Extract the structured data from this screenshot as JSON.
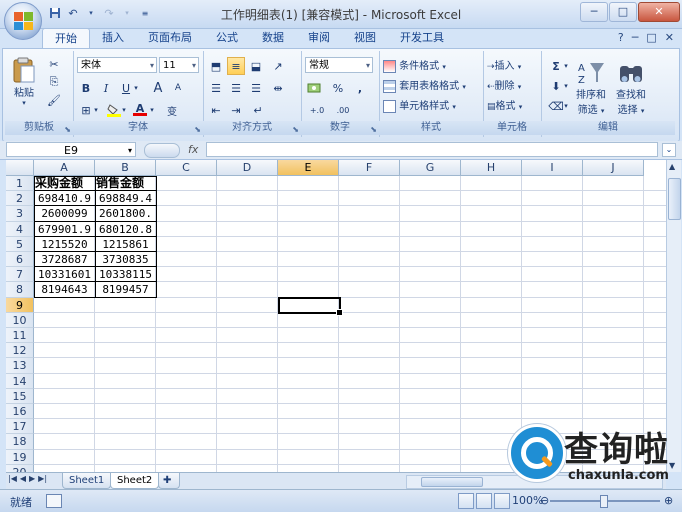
{
  "window": {
    "title": "工作明细表(1)  [兼容模式] - Microsoft Excel",
    "minimize": "─",
    "maximize": "□",
    "close": "✕"
  },
  "ribbon": {
    "tabs": [
      "开始",
      "插入",
      "页面布局",
      "公式",
      "数据",
      "审阅",
      "视图",
      "开发工具"
    ],
    "active_tab": "开始",
    "help_icons": [
      "?",
      "─",
      "□",
      "✕"
    ],
    "clipboard": {
      "paste": "粘贴",
      "label": "剪贴板"
    },
    "font": {
      "name": "宋体",
      "size": "11",
      "bold": "B",
      "italic": "I",
      "underline": "U",
      "grow": "A",
      "shrink": "A",
      "color_a": "A",
      "wen": "变",
      "label": "字体"
    },
    "alignment": {
      "label": "对齐方式"
    },
    "number": {
      "format": "常规",
      "percent": "%",
      "comma": ",",
      "label": "数字"
    },
    "styles": {
      "conditional": "条件格式",
      "table": "套用表格格式",
      "cell": "单元格样式",
      "label": "样式"
    },
    "cells": {
      "insert": "插入",
      "delete": "删除",
      "format": "格式",
      "label": "单元格"
    },
    "editing": {
      "sum": "Σ",
      "sort": "排序和\n筛选",
      "sort_line1": "排序和",
      "sort_line2": "筛选",
      "find_line1": "查找和",
      "find_line2": "选择",
      "label": "编辑"
    }
  },
  "formula_bar": {
    "name_box": "E9",
    "fx": "fx",
    "value": ""
  },
  "sheet": {
    "columns": [
      "A",
      "B",
      "C",
      "D",
      "E",
      "F",
      "G",
      "H",
      "I",
      "J"
    ],
    "rows": [
      "1",
      "2",
      "3",
      "4",
      "5",
      "6",
      "7",
      "8",
      "9",
      "10",
      "11",
      "12",
      "13",
      "14",
      "15",
      "16",
      "17",
      "18",
      "19",
      "20"
    ],
    "selected_cell": "E9",
    "headers": [
      "采购金额",
      "销售金额"
    ],
    "data": [
      [
        "698410.9",
        "698849.4"
      ],
      [
        "2600099",
        "2601800."
      ],
      [
        "679901.9",
        "680120.8"
      ],
      [
        "1215520",
        "1215861"
      ],
      [
        "3728687",
        "3730835"
      ],
      [
        "10331601",
        "10338115"
      ],
      [
        "8194643",
        "8199457"
      ]
    ]
  },
  "sheet_tabs": [
    "Sheet1",
    "Sheet2"
  ],
  "active_sheet": "Sheet2",
  "status_bar": {
    "ready": "就绪",
    "zoom": "100%",
    "zoom_minus": "⊖",
    "zoom_plus": "⊕"
  },
  "watermark": {
    "cn_text": "查询啦",
    "url": "chaxunla.com"
  }
}
